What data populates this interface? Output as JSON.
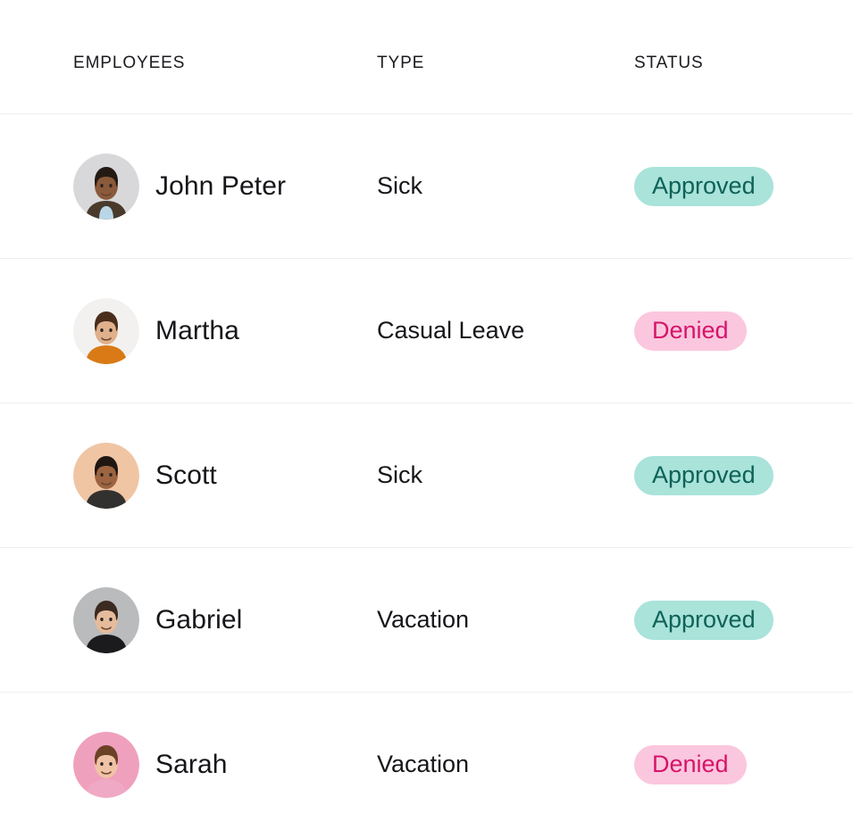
{
  "card": {
    "background": "#ffffff",
    "divider_color": "#eceef0"
  },
  "table": {
    "columns": [
      {
        "key": "employees",
        "label": "EMPLOYEES"
      },
      {
        "key": "type",
        "label": "TYPE"
      },
      {
        "key": "status",
        "label": "STATUS"
      }
    ],
    "rows": [
      {
        "name": "John Peter",
        "type": "Sick",
        "status": "Approved",
        "status_kind": "approved",
        "avatar": {
          "name": "avatar-john-peter",
          "bg": "#d8d8da",
          "skin": "#8a5a3b",
          "hair": "#241a14",
          "clothes": "#4a3a2c",
          "shirt": "#b9d6e8"
        }
      },
      {
        "name": "Martha",
        "type": "Casual Leave",
        "status": "Denied",
        "status_kind": "denied",
        "avatar": {
          "name": "avatar-martha",
          "bg": "#f2f1f0",
          "skin": "#e0b08c",
          "hair": "#4a2e1c",
          "clothes": "#d97a16",
          "shirt": "#d97a16"
        }
      },
      {
        "name": "Scott",
        "type": "Sick",
        "status": "Approved",
        "status_kind": "approved",
        "avatar": {
          "name": "avatar-scott",
          "bg": "#f0c5a4",
          "skin": "#9c6440",
          "hair": "#201713",
          "clothes": "#33312f",
          "shirt": "#33312f"
        }
      },
      {
        "name": "Gabriel",
        "type": "Vacation",
        "status": "Approved",
        "status_kind": "approved",
        "avatar": {
          "name": "avatar-gabriel",
          "bg": "#b9bbbd",
          "skin": "#e6bb9c",
          "hair": "#3b2a20",
          "clothes": "#1b1b1d",
          "shirt": "#1b1b1d"
        }
      },
      {
        "name": "Sarah",
        "type": "Vacation",
        "status": "Denied",
        "status_kind": "denied",
        "avatar": {
          "name": "avatar-sarah",
          "bg": "#efa0bd",
          "skin": "#f0c3a6",
          "hair": "#6b4226",
          "clothes": "#f0a9c4",
          "shirt": "#f0a9c4"
        }
      }
    ]
  },
  "status_colors": {
    "approved_bg": "#a9e3da",
    "approved_text": "#0f6158",
    "denied_bg": "#fbc7de",
    "denied_text": "#d6136a"
  }
}
